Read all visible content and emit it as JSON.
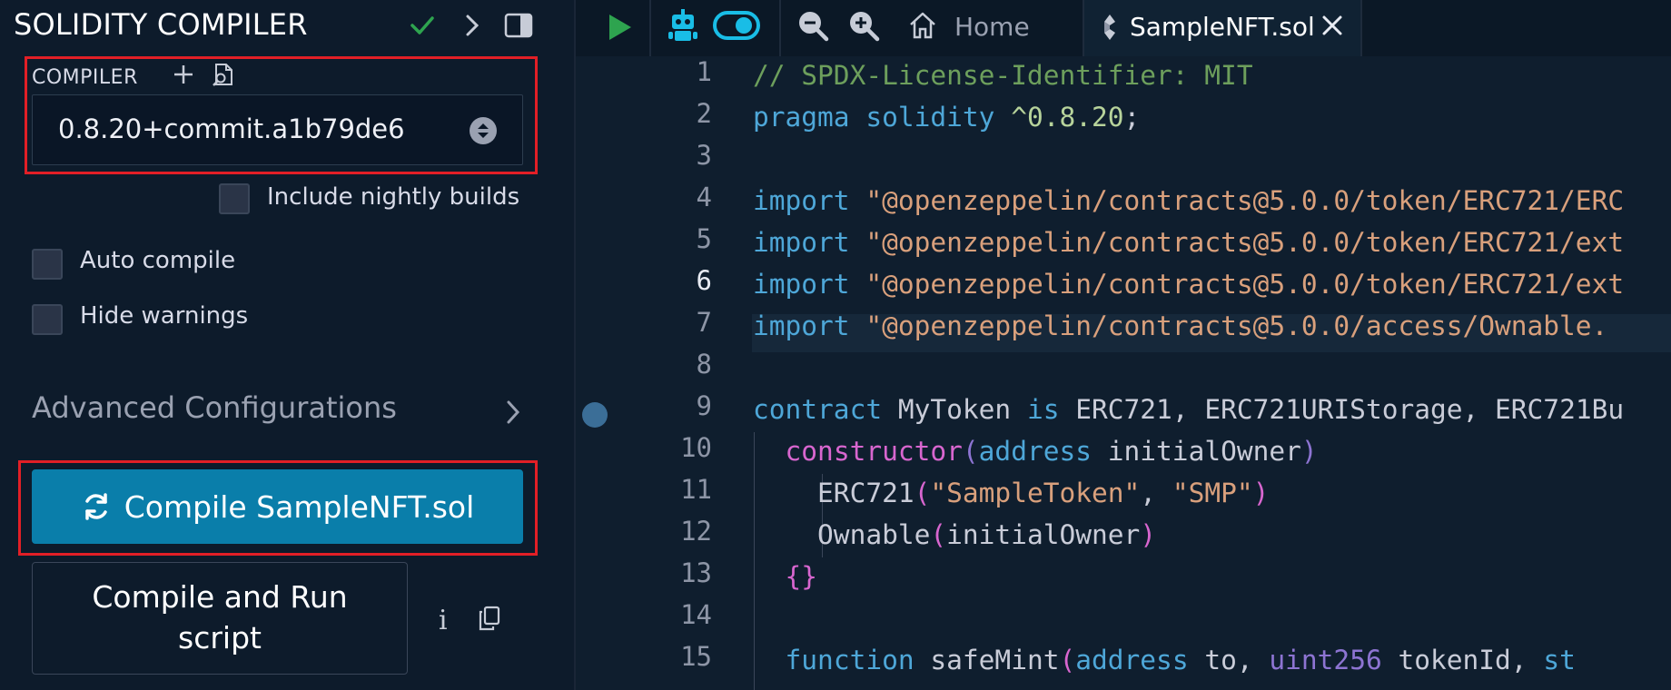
{
  "panel": {
    "title": "SOLIDITY COMPILER",
    "compiler_label": "COMPILER",
    "compiler_version": "0.8.20+commit.a1b79de6",
    "nightly_label": "Include nightly builds",
    "auto_compile_label": "Auto compile",
    "hide_warnings_label": "Hide warnings",
    "advanced_label": "Advanced Configurations",
    "compile_button": "Compile SampleNFT.sol",
    "compile_run_button": "Compile and Run script",
    "info_glyph": "i"
  },
  "tabs": {
    "home": "Home",
    "file": "SampleNFT.sol"
  },
  "editor": {
    "line_numbers": [
      "1",
      "2",
      "3",
      "4",
      "5",
      "6",
      "7",
      "8",
      "9",
      "10",
      "11",
      "12",
      "13",
      "14",
      "15"
    ],
    "active_line": "6",
    "lines": {
      "l1": "// SPDX-License-Identifier: MIT",
      "l2_kw": "pragma solidity",
      "l2_ver": "^0.8.20",
      "l2_end": ";",
      "l4_kw": "import",
      "l4_str": "\"@openzeppelin/contracts@5.0.0/token/ERC721/ERC",
      "l5_kw": "import",
      "l5_str": "\"@openzeppelin/contracts@5.0.0/token/ERC721/ext",
      "l6_kw": "import",
      "l6_str": "\"@openzeppelin/contracts@5.0.0/token/ERC721/ext",
      "l7_kw": "import",
      "l7_str": "\"@openzeppelin/contracts@5.0.0/access/Ownable.",
      "l9_kw": "contract",
      "l9_name": "MyToken",
      "l9_is": "is",
      "l9_rest": "ERC721, ERC721URIStorage, ERC721Bu",
      "l10_ctor": "constructor",
      "l10_paren_open": "(",
      "l10_type": "address",
      "l10_param": "initialOwner",
      "l10_paren_close": ")",
      "l11_call": "ERC721",
      "l11_po": "(",
      "l11_str1": "\"SampleToken\"",
      "l11_comma": ", ",
      "l11_str2": "\"SMP\"",
      "l11_pc": ")",
      "l12_call": "Ownable",
      "l12_po": "(",
      "l12_arg": "initialOwner",
      "l12_pc": ")",
      "l13": "{}",
      "l15_kw": "function",
      "l15_name": "safeMint",
      "l15_po": "(",
      "l15_t1": "address",
      "l15_p1": "to, ",
      "l15_t2": "uint256",
      "l15_p2": "tokenId, ",
      "l15_t3": "st"
    }
  },
  "colors": {
    "accent_blue": "#0a7eaa",
    "highlight_red": "#e21f26",
    "success_green": "#2ea44f",
    "icon_cyan": "#19bde6"
  }
}
